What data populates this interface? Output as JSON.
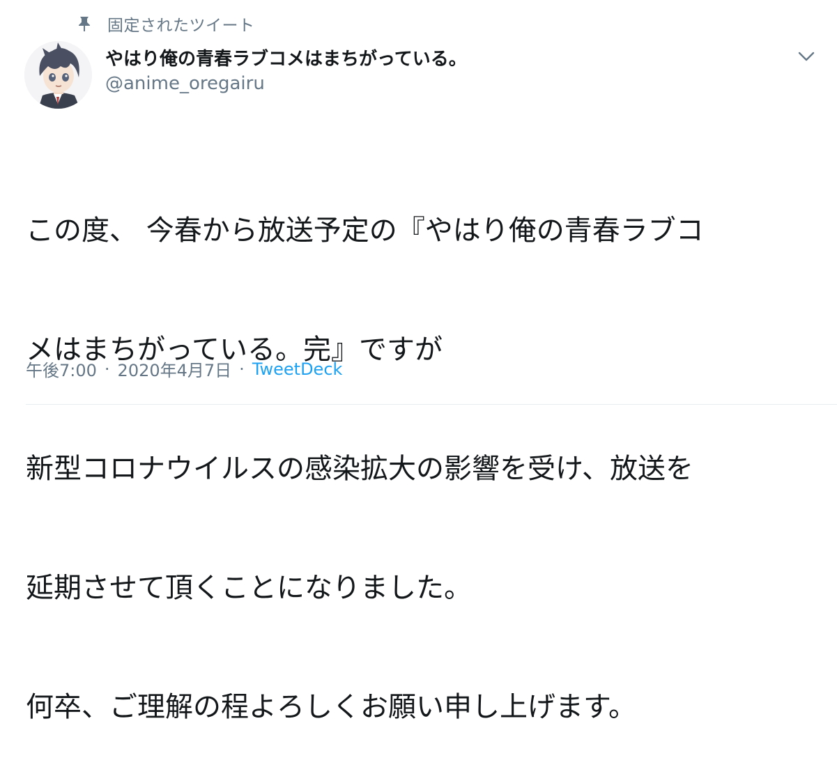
{
  "pinned": {
    "icon": "pin-icon",
    "label": "固定されたツイート"
  },
  "author": {
    "avatar_icon": "anime-character-avatar",
    "name": "やはり俺の青春ラブコメはまちがっている。",
    "handle": "@anime_oregairu"
  },
  "menu": {
    "icon": "chevron-down-icon"
  },
  "tweet": {
    "lines": [
      "この度、 今春から放送予定の『やはり俺の青春ラブコ",
      "メはまちがっている。完』ですが",
      "新型コロナウイルスの感染拡大の影響を受け、放送を",
      "延期させて頂くことになりました。",
      "何卒、ご理解の程よろしくお願い申し上げます。"
    ]
  },
  "meta": {
    "time": "午後7:00",
    "separator_1": "·",
    "date": "2020年4月7日",
    "separator_2": "·",
    "source": "TweetDeck"
  },
  "colors": {
    "text": "#14171a",
    "secondary": "#657786",
    "link": "#1da1f2",
    "divider": "#e6ecf0"
  }
}
